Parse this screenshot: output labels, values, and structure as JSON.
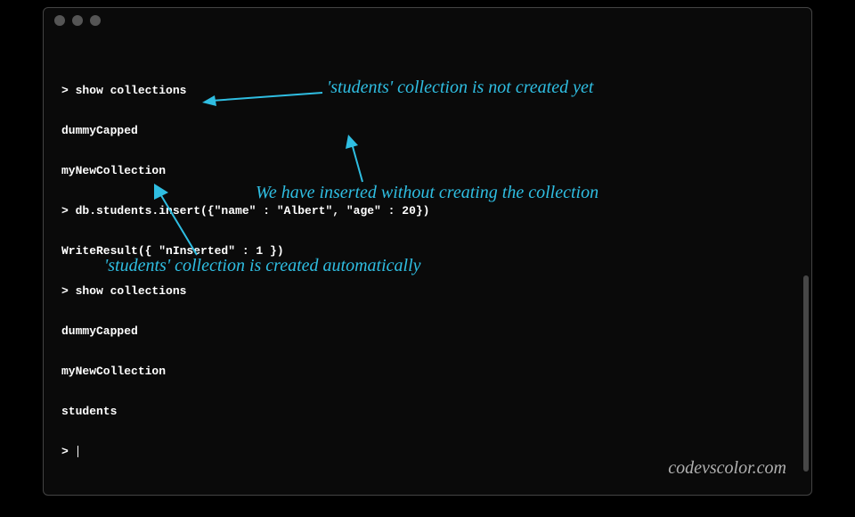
{
  "terminal": {
    "lines": [
      "> show collections",
      "dummyCapped",
      "myNewCollection",
      "> db.students.insert({\"name\" : \"Albert\", \"age\" : 20})",
      "WriteResult({ \"nInserted\" : 1 })",
      "> show collections",
      "dummyCapped",
      "myNewCollection",
      "students",
      "> "
    ]
  },
  "annotations": {
    "a1": "'students' collection is not created yet",
    "a2": "We have inserted without creating the collection",
    "a3": "'students' collection is created automatically"
  },
  "watermark": "codevscolor.com"
}
